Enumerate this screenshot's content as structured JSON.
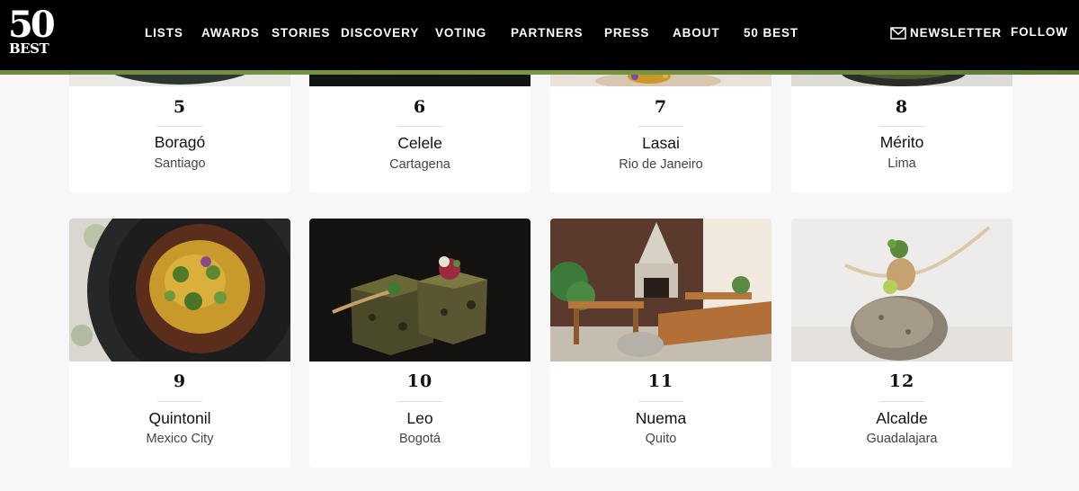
{
  "header": {
    "logo_number": "50",
    "logo_word": "BEST",
    "nav": [
      "LISTS",
      "AWARDS",
      "STORIES",
      "DISCOVERY",
      "VOTING",
      "PARTNERS",
      "PRESS",
      "ABOUT",
      "50 BEST"
    ],
    "newsletter_label": "NEWSLETTER",
    "follow_label": "FOLLOW",
    "accent_color": "#6e8a3a"
  },
  "restaurants": [
    {
      "rank": "5",
      "name": "Boragó",
      "city": "Santiago"
    },
    {
      "rank": "6",
      "name": "Celele",
      "city": "Cartagena"
    },
    {
      "rank": "7",
      "name": "Lasai",
      "city": "Rio de Janeiro"
    },
    {
      "rank": "8",
      "name": "Mérito",
      "city": "Lima"
    },
    {
      "rank": "9",
      "name": "Quintonil",
      "city": "Mexico City"
    },
    {
      "rank": "10",
      "name": "Leo",
      "city": "Bogotá"
    },
    {
      "rank": "11",
      "name": "Nuema",
      "city": "Quito"
    },
    {
      "rank": "12",
      "name": "Alcalde",
      "city": "Guadalajara"
    }
  ]
}
